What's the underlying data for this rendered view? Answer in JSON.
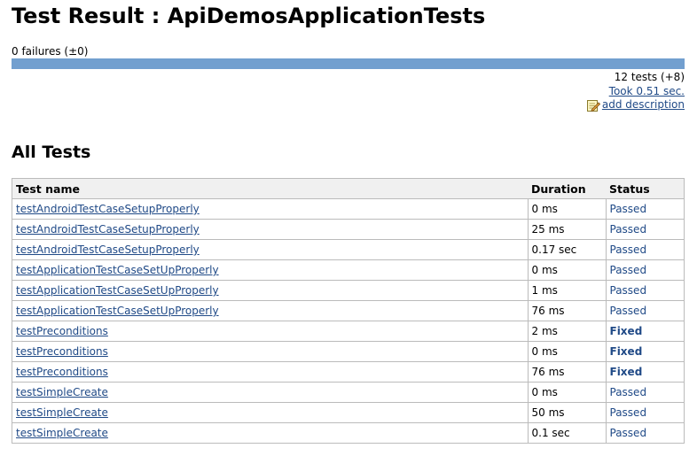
{
  "header": {
    "title": "Test Result : ApiDemosApplicationTests",
    "failures_text": "0 failures (±0)",
    "progress_passed_fraction": 1.0
  },
  "summary": {
    "tests_text": "12 tests (+8)",
    "took_text": "Took 0.51 sec.",
    "add_description_text": "add description"
  },
  "section": {
    "title": "All Tests"
  },
  "table": {
    "columns": [
      "Test name",
      "Duration",
      "Status"
    ],
    "rows": [
      {
        "name": "testAndroidTestCaseSetupProperly",
        "duration": "0 ms",
        "status": "Passed"
      },
      {
        "name": "testAndroidTestCaseSetupProperly",
        "duration": "25 ms",
        "status": "Passed"
      },
      {
        "name": "testAndroidTestCaseSetupProperly",
        "duration": "0.17 sec",
        "status": "Passed"
      },
      {
        "name": "testApplicationTestCaseSetUpProperly",
        "duration": "0 ms",
        "status": "Passed"
      },
      {
        "name": "testApplicationTestCaseSetUpProperly",
        "duration": "1 ms",
        "status": "Passed"
      },
      {
        "name": "testApplicationTestCaseSetUpProperly",
        "duration": "76 ms",
        "status": "Passed"
      },
      {
        "name": "testPreconditions",
        "duration": "2 ms",
        "status": "Fixed"
      },
      {
        "name": "testPreconditions",
        "duration": "0 ms",
        "status": "Fixed"
      },
      {
        "name": "testPreconditions",
        "duration": "76 ms",
        "status": "Fixed"
      },
      {
        "name": "testSimpleCreate",
        "duration": "0 ms",
        "status": "Passed"
      },
      {
        "name": "testSimpleCreate",
        "duration": "50 ms",
        "status": "Passed"
      },
      {
        "name": "testSimpleCreate",
        "duration": "0.1 sec",
        "status": "Passed"
      }
    ]
  },
  "colors": {
    "progress_bar": "#729fcf",
    "link": "#204a87",
    "header_bg": "#f0f0f0"
  },
  "icons": {
    "add_description": "notepad-pencil-icon"
  }
}
